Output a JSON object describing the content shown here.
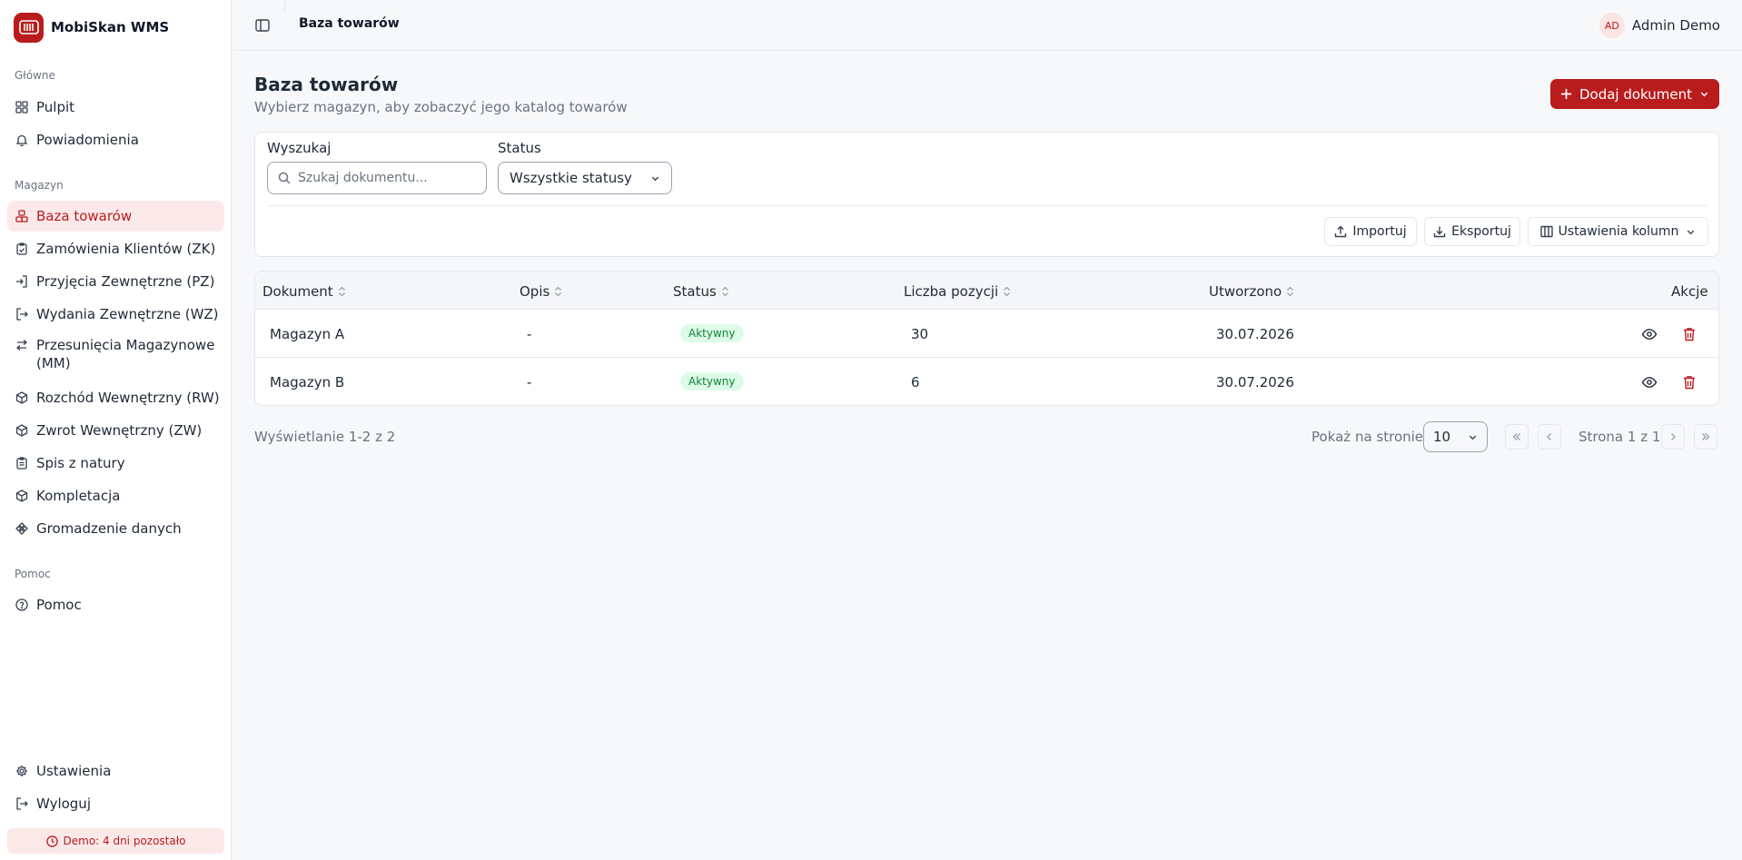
{
  "app": {
    "name": "MobiSkan WMS"
  },
  "sidebar": {
    "sections": [
      {
        "label": "Główne"
      },
      {
        "label": "Magazyn"
      },
      {
        "label": "Pomoc"
      }
    ],
    "items": [
      {
        "label": "Pulpit",
        "icon": "grid-icon"
      },
      {
        "label": "Powiadomienia",
        "icon": "bell-icon"
      },
      {
        "label": "Baza towarów",
        "icon": "boxes-icon",
        "active": true
      },
      {
        "label": "Zamówienia Klientów (ZK)",
        "icon": "clipboard-check-icon"
      },
      {
        "label": "Przyjęcia Zewnętrzne (PZ)",
        "icon": "login-icon"
      },
      {
        "label": "Wydania Zewnętrzne (WZ)",
        "icon": "logout-icon"
      },
      {
        "label": "Przesunięcia Magazynowe (MM)",
        "icon": "arrows-swap-icon"
      },
      {
        "label": "Rozchód Wewnętrzny (RW)",
        "icon": "package-icon"
      },
      {
        "label": "Zwrot Wewnętrzny (ZW)",
        "icon": "package-return-icon"
      },
      {
        "label": "Spis z natury",
        "icon": "clipboard-list-icon"
      },
      {
        "label": "Kompletacja",
        "icon": "package-check-icon"
      },
      {
        "label": "Gromadzenie danych",
        "icon": "nodes-icon"
      },
      {
        "label": "Pomoc",
        "icon": "help-circle-icon"
      },
      {
        "label": "Ustawienia",
        "icon": "gear-icon"
      },
      {
        "label": "Wyloguj",
        "icon": "logout-icon"
      }
    ],
    "demo_notice": "Demo: 4 dni pozostało"
  },
  "topbar": {
    "title": "Baza towarów",
    "user": {
      "initials": "AD",
      "name": "Admin Demo"
    }
  },
  "page": {
    "title": "Baza towarów",
    "subtitle": "Wybierz magazyn, aby zobaczyć jego katalog towarów",
    "add_button": "Dodaj dokument"
  },
  "filters": {
    "search_label": "Wyszukaj",
    "search_placeholder": "Szukaj dokumentu...",
    "search_value": "",
    "status_label": "Status",
    "status_value": "Wszystkie statusy",
    "import_label": "Importuj",
    "export_label": "Eksportuj",
    "columns_label": "Ustawienia kolumn"
  },
  "table": {
    "columns": [
      "Dokument",
      "Opis",
      "Status",
      "Liczba pozycji",
      "Utworzono",
      "Akcje"
    ],
    "rows": [
      {
        "document": "Magazyn A",
        "description": "-",
        "status": "Aktywny",
        "items": "30",
        "created": "30.07.2026"
      },
      {
        "document": "Magazyn B",
        "description": "-",
        "status": "Aktywny",
        "items": "6",
        "created": "30.07.2026"
      }
    ]
  },
  "pagination": {
    "showing": "Wyświetlanie 1-2 z 2",
    "per_page_label": "Pokaż na stronie",
    "per_page_value": "10",
    "page_info": "Strona 1 z 1"
  },
  "colors": {
    "accent": "#b91c1c",
    "accent_soft": "#fbe9ea",
    "status_active_bg": "#dcfce7",
    "status_active_text": "#15803d"
  }
}
